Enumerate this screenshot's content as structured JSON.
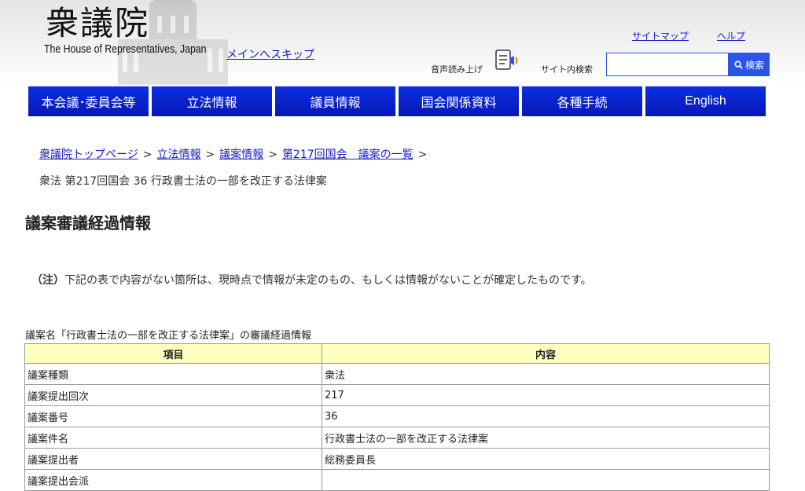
{
  "header": {
    "logo_kanji": "衆議院",
    "logo_english": "The House of Representatives, Japan",
    "skip_link": "メインへスキップ",
    "sitemap": "サイトマップ",
    "help": "ヘルプ",
    "voice_label": "音声読み上げ",
    "search_label": "サイト内検索",
    "search_value": "",
    "search_placeholder": "",
    "search_button": "検索"
  },
  "nav": {
    "items": [
      "本会議･委員会等",
      "立法情報",
      "議員情報",
      "国会関係資料",
      "各種手続",
      "English"
    ]
  },
  "breadcrumb": {
    "links": [
      "衆議院トップページ",
      "立法情報",
      "議案情報",
      "第217回国会　議案の一覧"
    ],
    "separator": ">",
    "current": "衆法 第217回国会 36 行政書士法の一部を改正する法律案"
  },
  "page": {
    "title": "議案審議経過情報",
    "note_prefix": "（注）",
    "note_text": "下記の表で内容がない箇所は、現時点で情報が未定のもの、もしくは情報がないことが確定したものです。",
    "table_caption": "議案名「行政書士法の一部を改正する法律案」の審議経過情報"
  },
  "table": {
    "headers": [
      "項目",
      "内容"
    ],
    "rows": [
      [
        "議案種類",
        "衆法"
      ],
      [
        "議案提出回次",
        "217"
      ],
      [
        "議案番号",
        "36"
      ],
      [
        "議案件名",
        "行政書士法の一部を改正する法律案"
      ],
      [
        "議案提出者",
        "総務委員長"
      ],
      [
        "議案提出会派",
        ""
      ]
    ]
  },
  "colors": {
    "nav_blue": "#0b2fe0",
    "link_blue": "#1a1ac8",
    "table_header_bg": "#ffffc0",
    "search_button_bg": "#2b55e6"
  },
  "icons": [
    "diet-building-image",
    "speaker-icon",
    "search-icon"
  ]
}
